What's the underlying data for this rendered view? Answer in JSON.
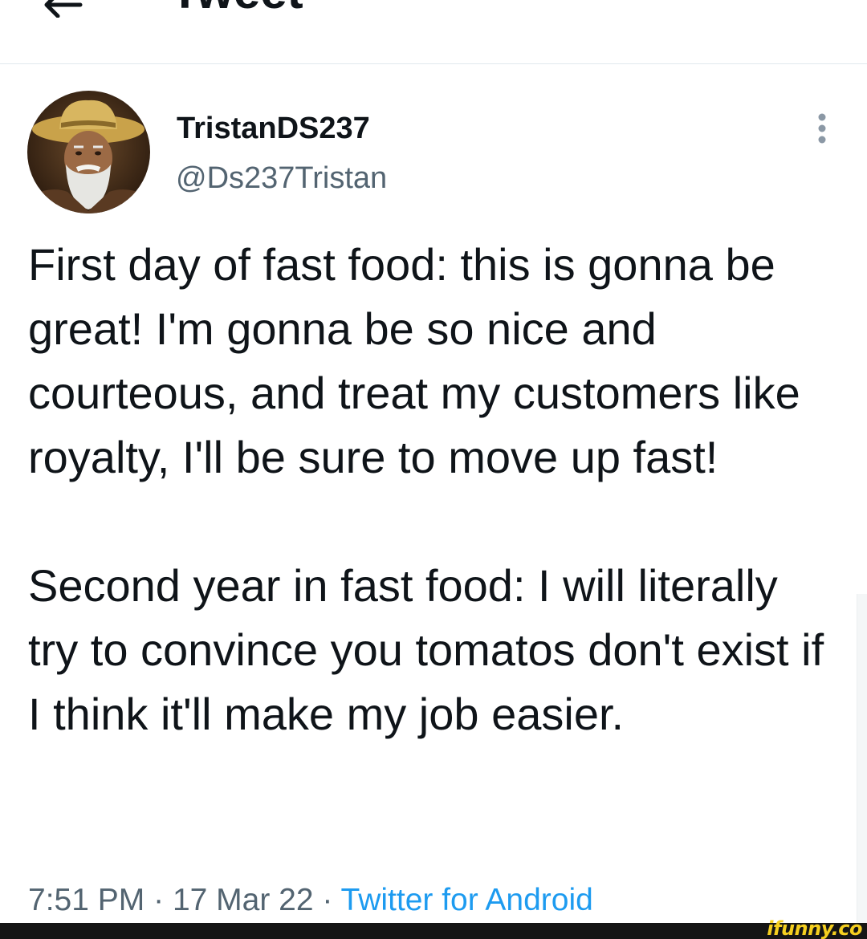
{
  "header": {
    "title": "Tweet",
    "back_icon": "arrow-left-icon"
  },
  "tweet": {
    "author": {
      "display_name": "TristanDS237",
      "handle": "@Ds237Tristan",
      "avatar_icon": "avatar-cowboy-portrait"
    },
    "more_icon": "more-vertical-icon",
    "paragraphs": [
      "First day of fast food: this is gonna be great! I'm gonna be so nice and courteous, and treat my customers like royalty, I'll be sure to move up fast!",
      "Second year in fast food: I will literally try to convince you tomatos don't exist if I think it'll make my job easier."
    ],
    "time": "7:51 PM",
    "separator": "·",
    "date": "17 Mar 22",
    "source": "Twitter for Android"
  },
  "watermark": {
    "text": "ifunny.co"
  },
  "colors": {
    "text_primary": "#0f1419",
    "text_secondary": "#536471",
    "link": "#1d9bf0",
    "watermark": "#f5cf1f"
  }
}
